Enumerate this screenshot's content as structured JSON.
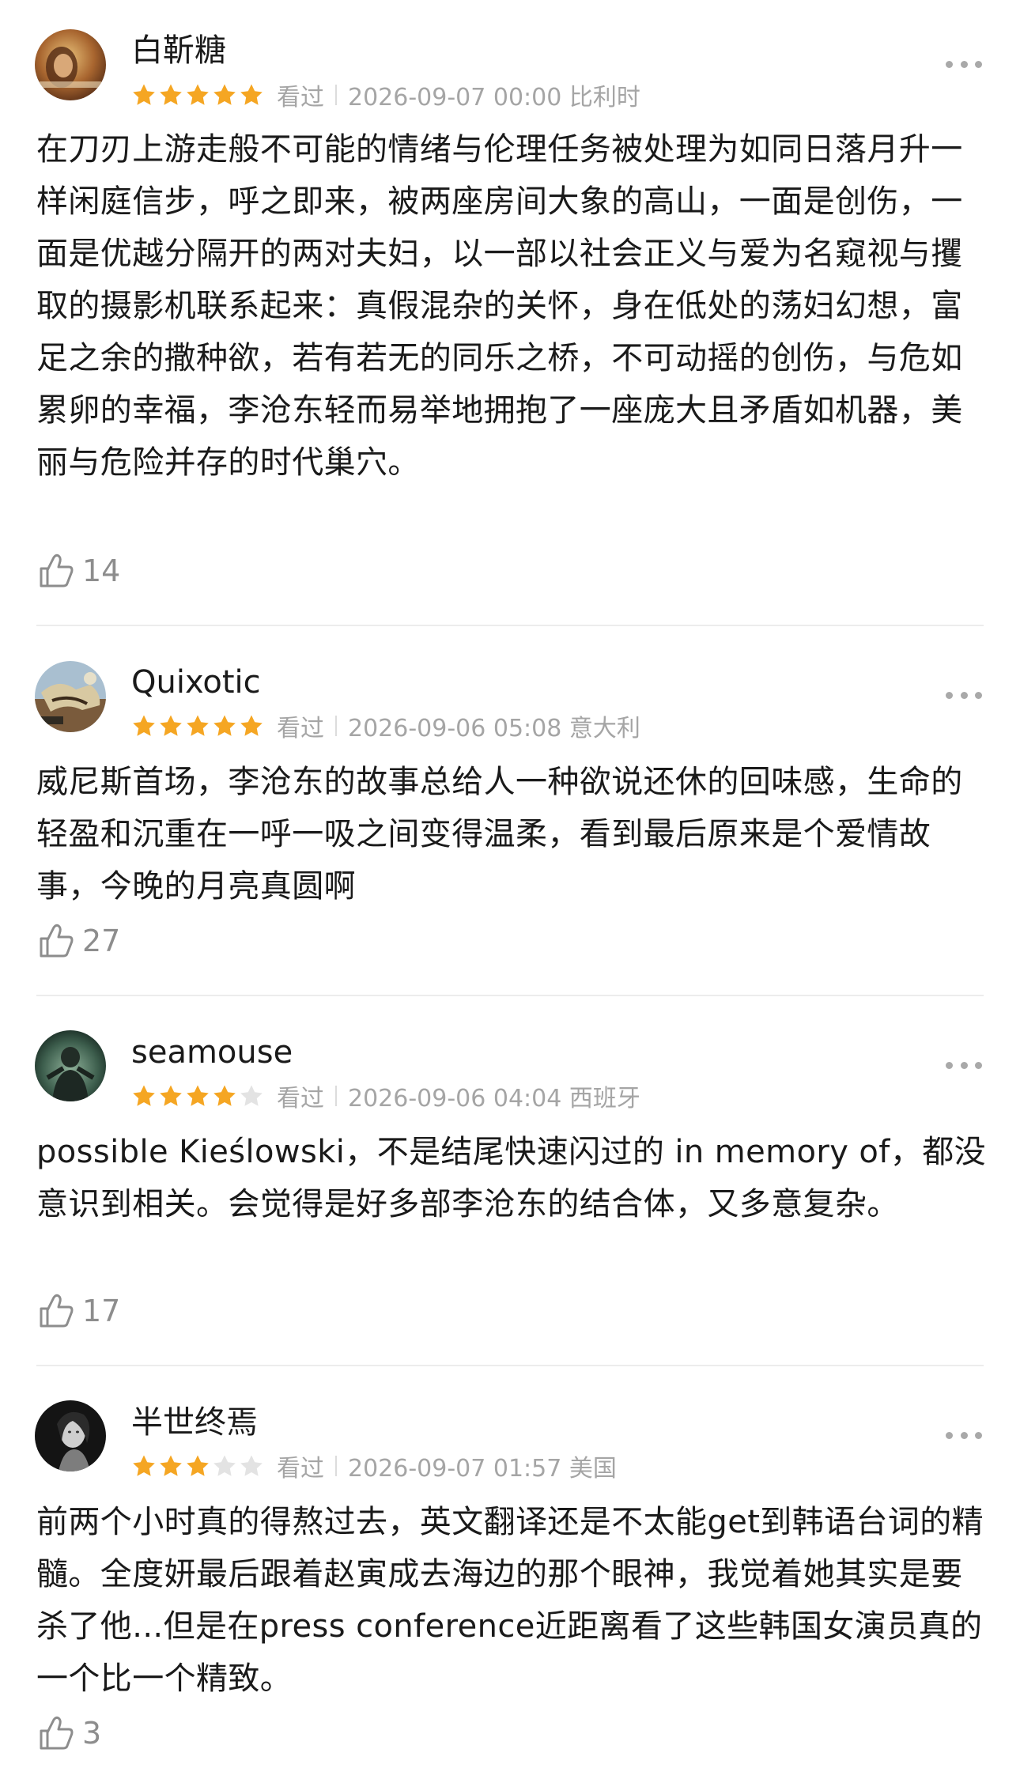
{
  "reviews": [
    {
      "username": "白靳糖",
      "rating": 5,
      "status": "看过",
      "date": "2026-09-07 00:00 比利时",
      "content": "在刀刃上游走般不可能的情绪与伦理任务被处理为如同日落月升一样闲庭信步，呼之即来，被两座房间大象的高山，一面是创伤，一面是优越分隔开的两对夫妇，以一部以社会正义与爱为名窥视与攫取的摄影机联系起来：真假混杂的关怀，身在低处的荡妇幻想，富足之余的撒种欲，若有若无的同乐之桥，不可动摇的创伤，与危如累卵的幸福，李沧东轻而易举地拥抱了一座庞大且矛盾如机器，美丽与危险并存的时代巢穴。",
      "likes": "14",
      "avatar_icon": "avatar-portrait-warm"
    },
    {
      "username": "Quixotic",
      "rating": 5,
      "status": "看过",
      "date": "2026-09-06 05:08 意大利",
      "content": "威尼斯首场，李沧东的故事总给人一种欲说还休的回味感，生命的轻盈和沉重在一呼一吸之间变得温柔，看到最后原来是个爱情故事，今晚的月亮真圆啊",
      "likes": "27",
      "avatar_icon": "avatar-painting"
    },
    {
      "username": "seamouse",
      "rating": 4,
      "status": "看过",
      "date": "2026-09-06 04:04 西班牙",
      "content": "possible Kieślowski，不是结尾快速闪过的 in memory of，都没意识到相关。会觉得是好多部李沧东的结合体，又多意复杂。",
      "likes": "17",
      "avatar_icon": "avatar-green-figure"
    },
    {
      "username": "半世终焉",
      "rating": 3,
      "status": "看过",
      "date": "2026-09-07 01:57 美国",
      "content": "前两个小时真的得熬过去，英文翻译还是不太能get到韩语台词的精髓。全度妍最后跟着赵寅成去海边的那个眼神，我觉着她其实是要杀了他...但是在press conference近距离看了这些韩国女演员真的一个比一个精致。",
      "likes": "3",
      "avatar_icon": "avatar-bw-portrait"
    }
  ],
  "colors": {
    "star_filled": "#F5A623",
    "star_empty": "#E3E3E3",
    "meta_text": "#A5A5A5",
    "like_text": "#8D8D8D",
    "divider": "#ECECEC"
  },
  "icons": {
    "more": "more-icon",
    "like": "thumbs-up-icon",
    "star": "star-icon"
  }
}
